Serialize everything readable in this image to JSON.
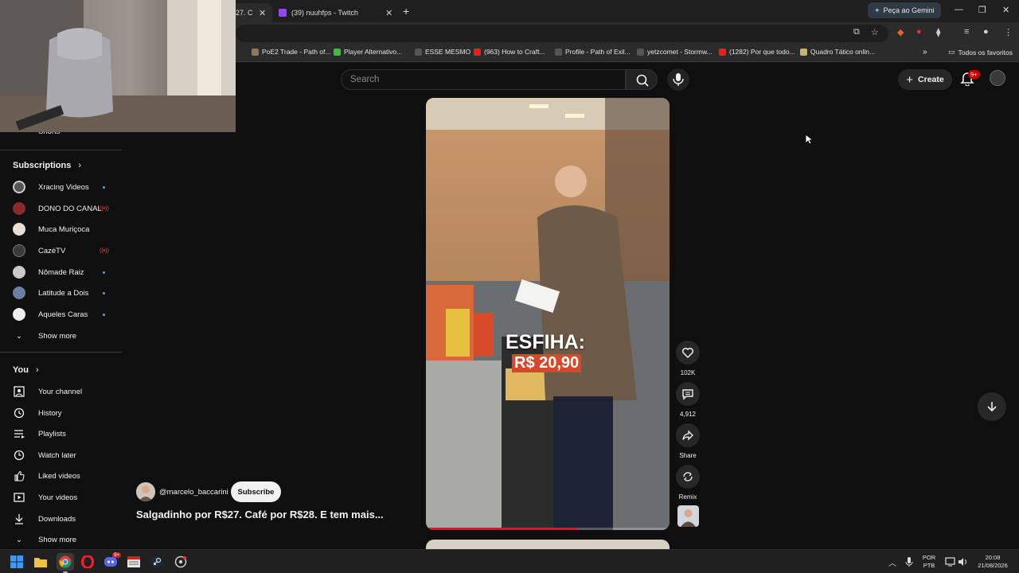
{
  "browser": {
    "tabs": [
      {
        "label": "27. C"
      },
      {
        "label": "(39) nuuhfps - Twitch"
      }
    ],
    "gemini_label": "Peça ao Gemini",
    "bookmarks": [
      {
        "label": "PoE2 Trade - Path of..."
      },
      {
        "label": "Player Alternativo..."
      },
      {
        "label": "ESSE MESMO"
      },
      {
        "label": "(963) How to Craft..."
      },
      {
        "label": "Profile - Path of Exil..."
      },
      {
        "label": "yetzcomet - Stormw..."
      },
      {
        "label": "(1282) Por que todo..."
      },
      {
        "label": "Quadro Tático onlin..."
      }
    ],
    "bookmarks_overflow": "»",
    "all_bookmarks": "Todos os favoritos"
  },
  "header": {
    "search_placeholder": "Search",
    "create_label": "Create",
    "notification_count": "9+"
  },
  "sidebar": {
    "partial_item": "Shorts",
    "subscriptions_title": "Subscriptions",
    "subscriptions": [
      {
        "label": "Xracing Videos",
        "status": "new",
        "color": "#555"
      },
      {
        "label": "DONO DO CANAL",
        "status": "live",
        "color": "#8a2a2a"
      },
      {
        "label": "Muca Muriçoca",
        "status": "",
        "color": "#e8e0d5"
      },
      {
        "label": "CazéTV",
        "status": "live",
        "color": "#3b3b3b"
      },
      {
        "label": "Nômade Raiz",
        "status": "new",
        "color": "#c9c9c9"
      },
      {
        "label": "Latitude a Dois",
        "status": "new",
        "color": "#6b7fa3"
      },
      {
        "label": "Aqueles Caras",
        "status": "new",
        "color": "#eeeeee"
      }
    ],
    "subs_show_more": "Show more",
    "you_title": "You",
    "you_items": [
      {
        "label": "Your channel",
        "icon": "your-channel-icon"
      },
      {
        "label": "History",
        "icon": "history-icon"
      },
      {
        "label": "Playlists",
        "icon": "playlists-icon"
      },
      {
        "label": "Watch later",
        "icon": "watch-later-icon"
      },
      {
        "label": "Liked videos",
        "icon": "liked-videos-icon"
      },
      {
        "label": "Your videos",
        "icon": "your-videos-icon"
      },
      {
        "label": "Downloads",
        "icon": "downloads-icon"
      },
      {
        "label": "Show more",
        "icon": "chevron-down-icon"
      }
    ]
  },
  "short": {
    "overlay_line1": "ESFIHA:",
    "overlay_line2": "R$ 20,90",
    "channel_handle": "@marcelo_baccarini",
    "subscribe_label": "Subscribe",
    "title": "Salgadinho por R$27. Café por R$28. E tem mais...",
    "progress": 0.62,
    "actions": {
      "like_count": "102K",
      "comment_count": "4,912",
      "share_label": "Share",
      "remix_label": "Remix"
    }
  },
  "taskbar": {
    "language": "POR",
    "layout": "PTB",
    "time": "20:08",
    "date": "21/08/2026",
    "discord_badge": "9+"
  }
}
